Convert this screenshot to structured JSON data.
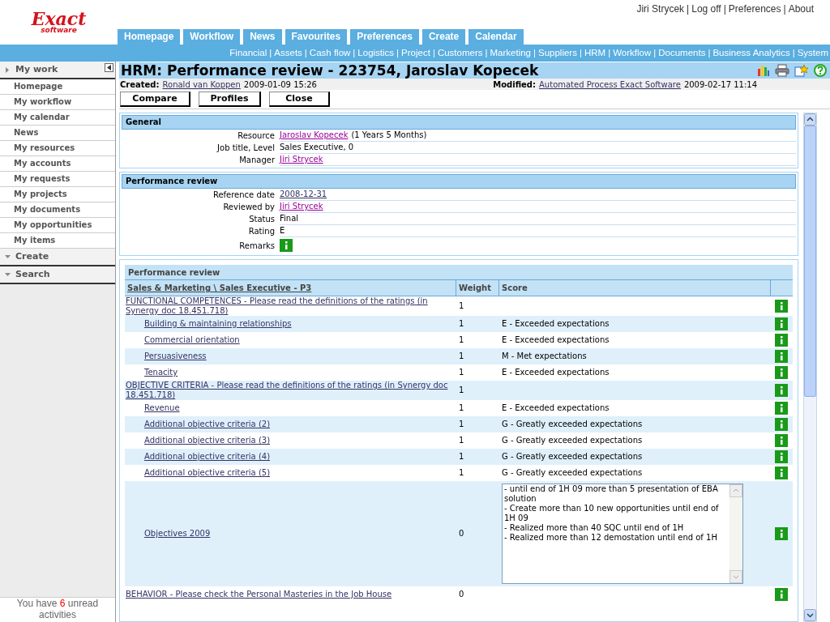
{
  "separator": "|",
  "user_links": [
    "Jiri Strycek",
    "Log off",
    "Preferences",
    "About"
  ],
  "logo": {
    "name": "Exact",
    "sub": "software"
  },
  "tabs": [
    "Homepage",
    "Workflow",
    "News",
    "Favourites",
    "Preferences",
    "Create",
    "Calendar"
  ],
  "modules": [
    "Financial",
    "Assets",
    "Cash flow",
    "Logistics",
    "Project",
    "Customers",
    "Marketing",
    "Suppliers",
    "HRM",
    "Workflow",
    "Documents",
    "Business Analytics",
    "System"
  ],
  "sidebar": {
    "sections": [
      {
        "title": "My work",
        "items": [
          "Homepage",
          "My workflow",
          "My calendar",
          "News",
          "My resources",
          "My accounts",
          "My requests",
          "My projects",
          "My documents",
          "My opportunities",
          "My items"
        ]
      },
      {
        "title": "Create"
      },
      {
        "title": "Search"
      }
    ],
    "unread": {
      "prefix": "You have",
      "count": "6",
      "suffix": "unread activities"
    }
  },
  "page": {
    "title": "HRM: Performance review - 223754, Jaroslav Kopecek",
    "created_label": "Created:",
    "created_by": "Ronald van Koppen",
    "created_at": "2009-01-09 15:26",
    "modified_label": "Modified:",
    "modified_by": "Automated Process Exact Software",
    "modified_at": "2009-02-17 11:14",
    "buttons": [
      "Compare",
      "Profiles",
      "Close"
    ]
  },
  "general": {
    "title": "General",
    "fields": [
      {
        "label": "Resource",
        "value": "Jaroslav Kopecek",
        "note": "(1 Years 5 Months)",
        "kind": "link"
      },
      {
        "label": "Job title, Level",
        "value": "Sales Executive, 0",
        "kind": "text"
      },
      {
        "label": "Manager",
        "value": "Jiri Strycek",
        "kind": "link"
      }
    ]
  },
  "review": {
    "title": "Performance review",
    "fields": [
      {
        "label": "Reference date",
        "value": "2008-12-31",
        "kind": "link"
      },
      {
        "label": "Reviewed by",
        "value": "Jiri Strycek",
        "kind": "link"
      },
      {
        "label": "Status",
        "value": "Final",
        "kind": "text"
      },
      {
        "label": "Rating",
        "value": "E",
        "kind": "text"
      },
      {
        "label": "Remarks",
        "kind": "info"
      }
    ]
  },
  "table": {
    "title": "Performance review",
    "columns": [
      "Sales & Marketing \\ Sales Executive - P3",
      "Weight",
      "Score"
    ],
    "groups": [
      {
        "name": "FUNCTIONAL COMPETENCES - Please read the definitions of the ratings (in Synergy doc 18.451.718)",
        "weight": "1",
        "children": [
          {
            "name": "Building & maintaining relationships",
            "weight": "1",
            "score": "E - Exceeded expectations"
          },
          {
            "name": "Commercial orientation",
            "weight": "1",
            "score": "E - Exceeded expectations"
          },
          {
            "name": "Persuasiveness",
            "weight": "1",
            "score": "M - Met expectations"
          },
          {
            "name": "Tenacity",
            "weight": "1",
            "score": "E - Exceeded expectations"
          }
        ]
      },
      {
        "name": "OBJECTIVE CRITERIA - Please read the definitions of the ratings (in Synergy doc 18.451.718)",
        "weight": "1",
        "children": [
          {
            "name": "Revenue",
            "weight": "1",
            "score": "E - Exceeded expectations"
          },
          {
            "name": "Additional objective criteria (2)",
            "weight": "1",
            "score": "G - Greatly exceeded expectations"
          },
          {
            "name": "Additional objective criteria (3)",
            "weight": "1",
            "score": "G - Greatly exceeded expectations"
          },
          {
            "name": "Additional objective criteria (4)",
            "weight": "1",
            "score": "G - Greatly exceeded expectations"
          },
          {
            "name": "Additional objective criteria (5)",
            "weight": "1",
            "score": "G - Greatly exceeded expectations"
          },
          {
            "name": "Objectives 2009",
            "weight": "0",
            "remarks": "- until end of 1H 09 more than 5 presentation of EBA solution\n- Create more than 10 new opportunities until end of 1H 09\n- Realized more than 40 SQC until end of 1H\n- Realized more than 12 demostation until end of 1H"
          }
        ]
      },
      {
        "name": "BEHAVIOR - Please check the Personal Masteries in the Job House",
        "weight": "0"
      }
    ]
  }
}
